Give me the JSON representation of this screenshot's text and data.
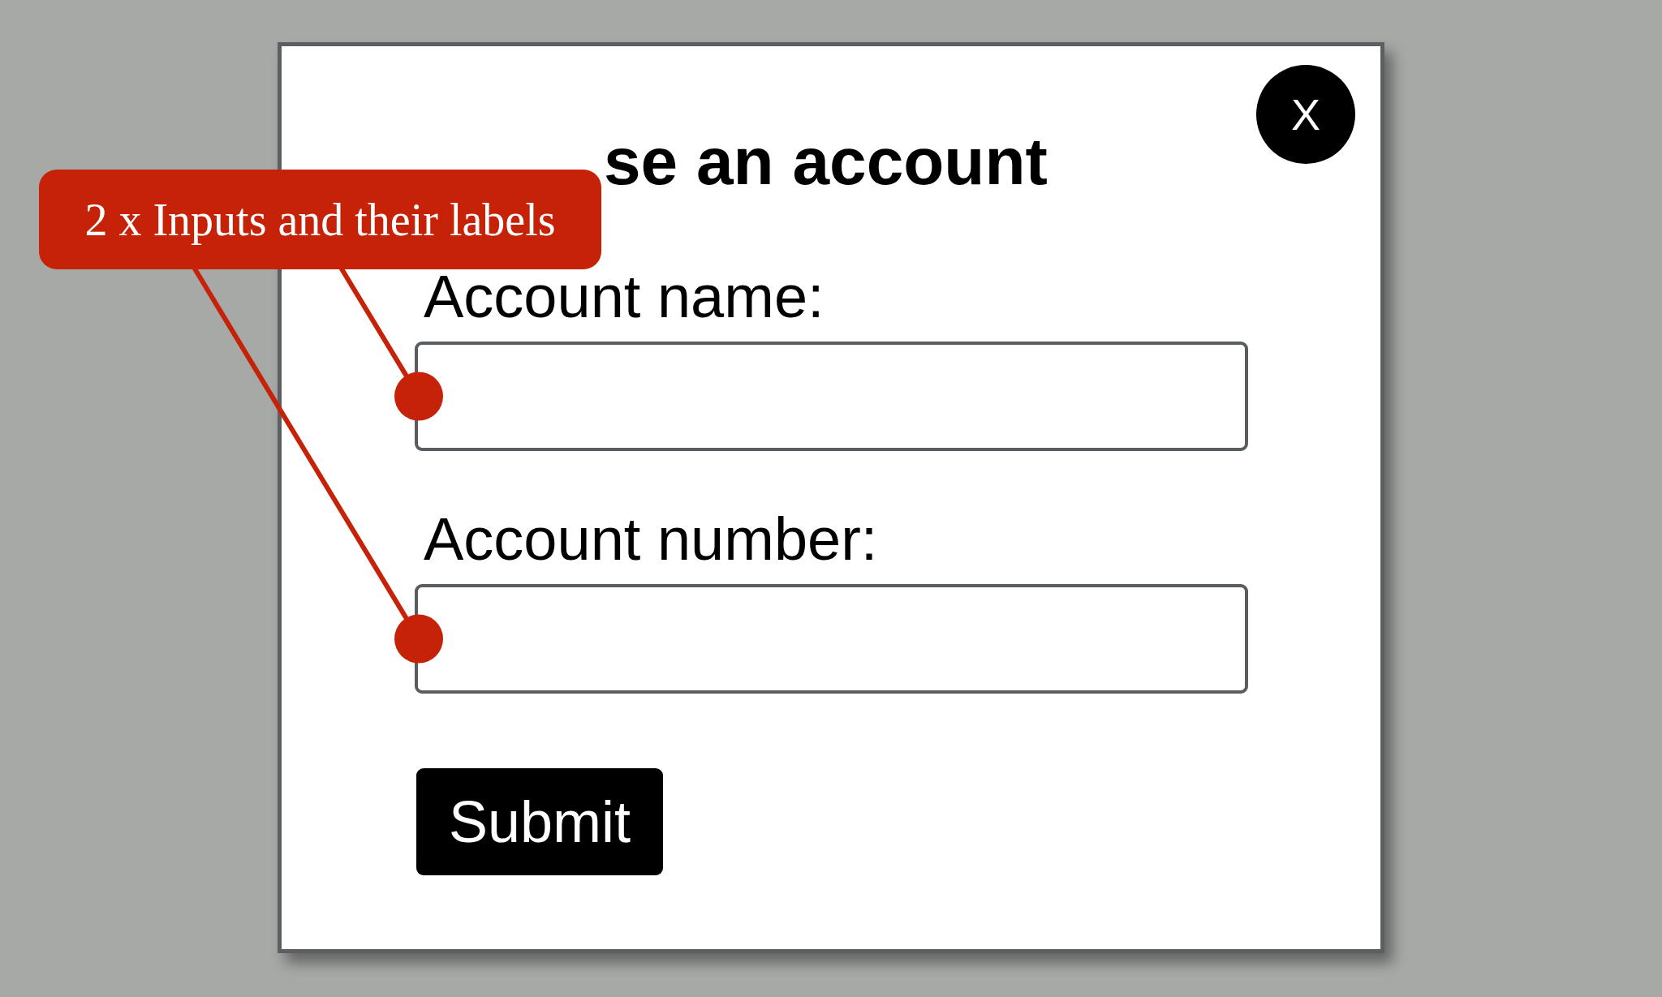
{
  "dialog": {
    "title": "se an account",
    "close_label": "X",
    "fields": [
      {
        "label": "Account name:",
        "annotated": true
      },
      {
        "label": "Account number:",
        "annotated": true
      }
    ],
    "submit_label": "Submit"
  },
  "annotation": {
    "text": "2 x Inputs and their labels"
  }
}
